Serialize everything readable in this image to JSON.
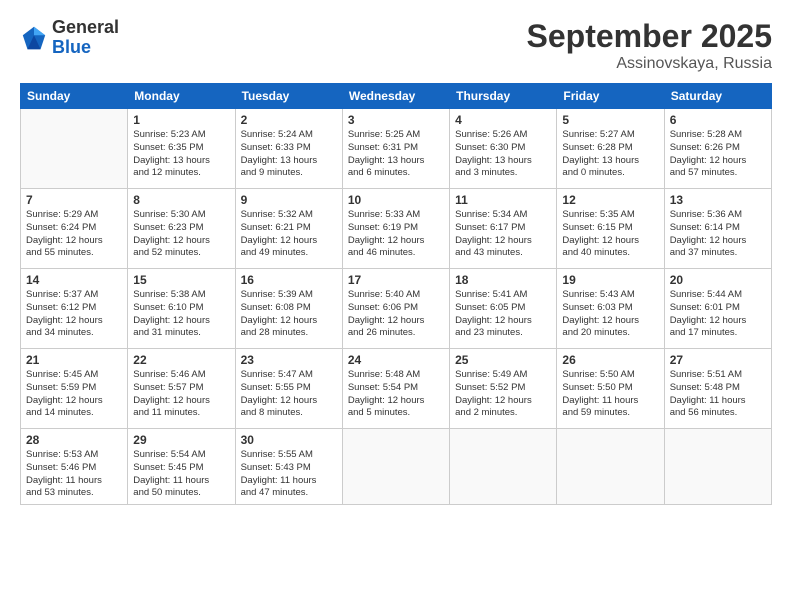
{
  "header": {
    "logo_general": "General",
    "logo_blue": "Blue",
    "month": "September 2025",
    "location": "Assinovskaya, Russia"
  },
  "days_of_week": [
    "Sunday",
    "Monday",
    "Tuesday",
    "Wednesday",
    "Thursday",
    "Friday",
    "Saturday"
  ],
  "weeks": [
    [
      {
        "day": "",
        "info": ""
      },
      {
        "day": "1",
        "info": "Sunrise: 5:23 AM\nSunset: 6:35 PM\nDaylight: 13 hours\nand 12 minutes."
      },
      {
        "day": "2",
        "info": "Sunrise: 5:24 AM\nSunset: 6:33 PM\nDaylight: 13 hours\nand 9 minutes."
      },
      {
        "day": "3",
        "info": "Sunrise: 5:25 AM\nSunset: 6:31 PM\nDaylight: 13 hours\nand 6 minutes."
      },
      {
        "day": "4",
        "info": "Sunrise: 5:26 AM\nSunset: 6:30 PM\nDaylight: 13 hours\nand 3 minutes."
      },
      {
        "day": "5",
        "info": "Sunrise: 5:27 AM\nSunset: 6:28 PM\nDaylight: 13 hours\nand 0 minutes."
      },
      {
        "day": "6",
        "info": "Sunrise: 5:28 AM\nSunset: 6:26 PM\nDaylight: 12 hours\nand 57 minutes."
      }
    ],
    [
      {
        "day": "7",
        "info": "Sunrise: 5:29 AM\nSunset: 6:24 PM\nDaylight: 12 hours\nand 55 minutes."
      },
      {
        "day": "8",
        "info": "Sunrise: 5:30 AM\nSunset: 6:23 PM\nDaylight: 12 hours\nand 52 minutes."
      },
      {
        "day": "9",
        "info": "Sunrise: 5:32 AM\nSunset: 6:21 PM\nDaylight: 12 hours\nand 49 minutes."
      },
      {
        "day": "10",
        "info": "Sunrise: 5:33 AM\nSunset: 6:19 PM\nDaylight: 12 hours\nand 46 minutes."
      },
      {
        "day": "11",
        "info": "Sunrise: 5:34 AM\nSunset: 6:17 PM\nDaylight: 12 hours\nand 43 minutes."
      },
      {
        "day": "12",
        "info": "Sunrise: 5:35 AM\nSunset: 6:15 PM\nDaylight: 12 hours\nand 40 minutes."
      },
      {
        "day": "13",
        "info": "Sunrise: 5:36 AM\nSunset: 6:14 PM\nDaylight: 12 hours\nand 37 minutes."
      }
    ],
    [
      {
        "day": "14",
        "info": "Sunrise: 5:37 AM\nSunset: 6:12 PM\nDaylight: 12 hours\nand 34 minutes."
      },
      {
        "day": "15",
        "info": "Sunrise: 5:38 AM\nSunset: 6:10 PM\nDaylight: 12 hours\nand 31 minutes."
      },
      {
        "day": "16",
        "info": "Sunrise: 5:39 AM\nSunset: 6:08 PM\nDaylight: 12 hours\nand 28 minutes."
      },
      {
        "day": "17",
        "info": "Sunrise: 5:40 AM\nSunset: 6:06 PM\nDaylight: 12 hours\nand 26 minutes."
      },
      {
        "day": "18",
        "info": "Sunrise: 5:41 AM\nSunset: 6:05 PM\nDaylight: 12 hours\nand 23 minutes."
      },
      {
        "day": "19",
        "info": "Sunrise: 5:43 AM\nSunset: 6:03 PM\nDaylight: 12 hours\nand 20 minutes."
      },
      {
        "day": "20",
        "info": "Sunrise: 5:44 AM\nSunset: 6:01 PM\nDaylight: 12 hours\nand 17 minutes."
      }
    ],
    [
      {
        "day": "21",
        "info": "Sunrise: 5:45 AM\nSunset: 5:59 PM\nDaylight: 12 hours\nand 14 minutes."
      },
      {
        "day": "22",
        "info": "Sunrise: 5:46 AM\nSunset: 5:57 PM\nDaylight: 12 hours\nand 11 minutes."
      },
      {
        "day": "23",
        "info": "Sunrise: 5:47 AM\nSunset: 5:55 PM\nDaylight: 12 hours\nand 8 minutes."
      },
      {
        "day": "24",
        "info": "Sunrise: 5:48 AM\nSunset: 5:54 PM\nDaylight: 12 hours\nand 5 minutes."
      },
      {
        "day": "25",
        "info": "Sunrise: 5:49 AM\nSunset: 5:52 PM\nDaylight: 12 hours\nand 2 minutes."
      },
      {
        "day": "26",
        "info": "Sunrise: 5:50 AM\nSunset: 5:50 PM\nDaylight: 11 hours\nand 59 minutes."
      },
      {
        "day": "27",
        "info": "Sunrise: 5:51 AM\nSunset: 5:48 PM\nDaylight: 11 hours\nand 56 minutes."
      }
    ],
    [
      {
        "day": "28",
        "info": "Sunrise: 5:53 AM\nSunset: 5:46 PM\nDaylight: 11 hours\nand 53 minutes."
      },
      {
        "day": "29",
        "info": "Sunrise: 5:54 AM\nSunset: 5:45 PM\nDaylight: 11 hours\nand 50 minutes."
      },
      {
        "day": "30",
        "info": "Sunrise: 5:55 AM\nSunset: 5:43 PM\nDaylight: 11 hours\nand 47 minutes."
      },
      {
        "day": "",
        "info": ""
      },
      {
        "day": "",
        "info": ""
      },
      {
        "day": "",
        "info": ""
      },
      {
        "day": "",
        "info": ""
      }
    ]
  ]
}
